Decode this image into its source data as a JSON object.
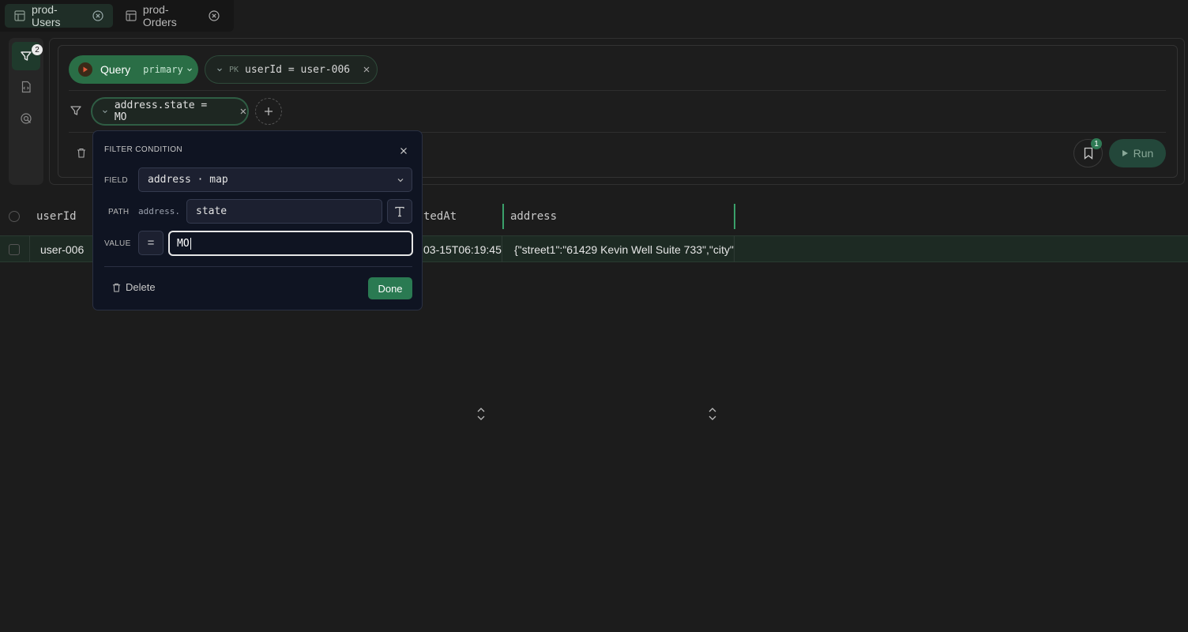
{
  "tabs": [
    {
      "label": "prod-Users",
      "active": true
    },
    {
      "label": "prod-Orders",
      "active": false
    }
  ],
  "rail": {
    "filter_badge": "2"
  },
  "query": {
    "label": "Query",
    "index": "primary",
    "pk_tag": "PK",
    "pk_condition": "userId = user-006"
  },
  "filters": {
    "chip": "address.state = MO"
  },
  "toolbar": {
    "bookmark_badge": "1",
    "run_label": "Run"
  },
  "table": {
    "columns": [
      "userId",
      "tedAt",
      "address"
    ],
    "rows": [
      {
        "userId": "user-006",
        "createdAt": "03-15T06:19:45",
        "address": "{\"street1\":\"61429 Kevin Well Suite 733\",\"city\""
      }
    ]
  },
  "popover": {
    "title": "FILTER CONDITION",
    "field_label": "FIELD",
    "field_value": "address · map",
    "path_label": "PATH",
    "path_prefix": "address.",
    "path_value": "state",
    "value_label": "VALUE",
    "operator": "=",
    "value": "MO",
    "delete_label": "Delete",
    "done_label": "Done"
  },
  "colors": {
    "accent": "#2a7a52",
    "background": "#1c1c1c",
    "popover_bg": "#0f1422"
  }
}
